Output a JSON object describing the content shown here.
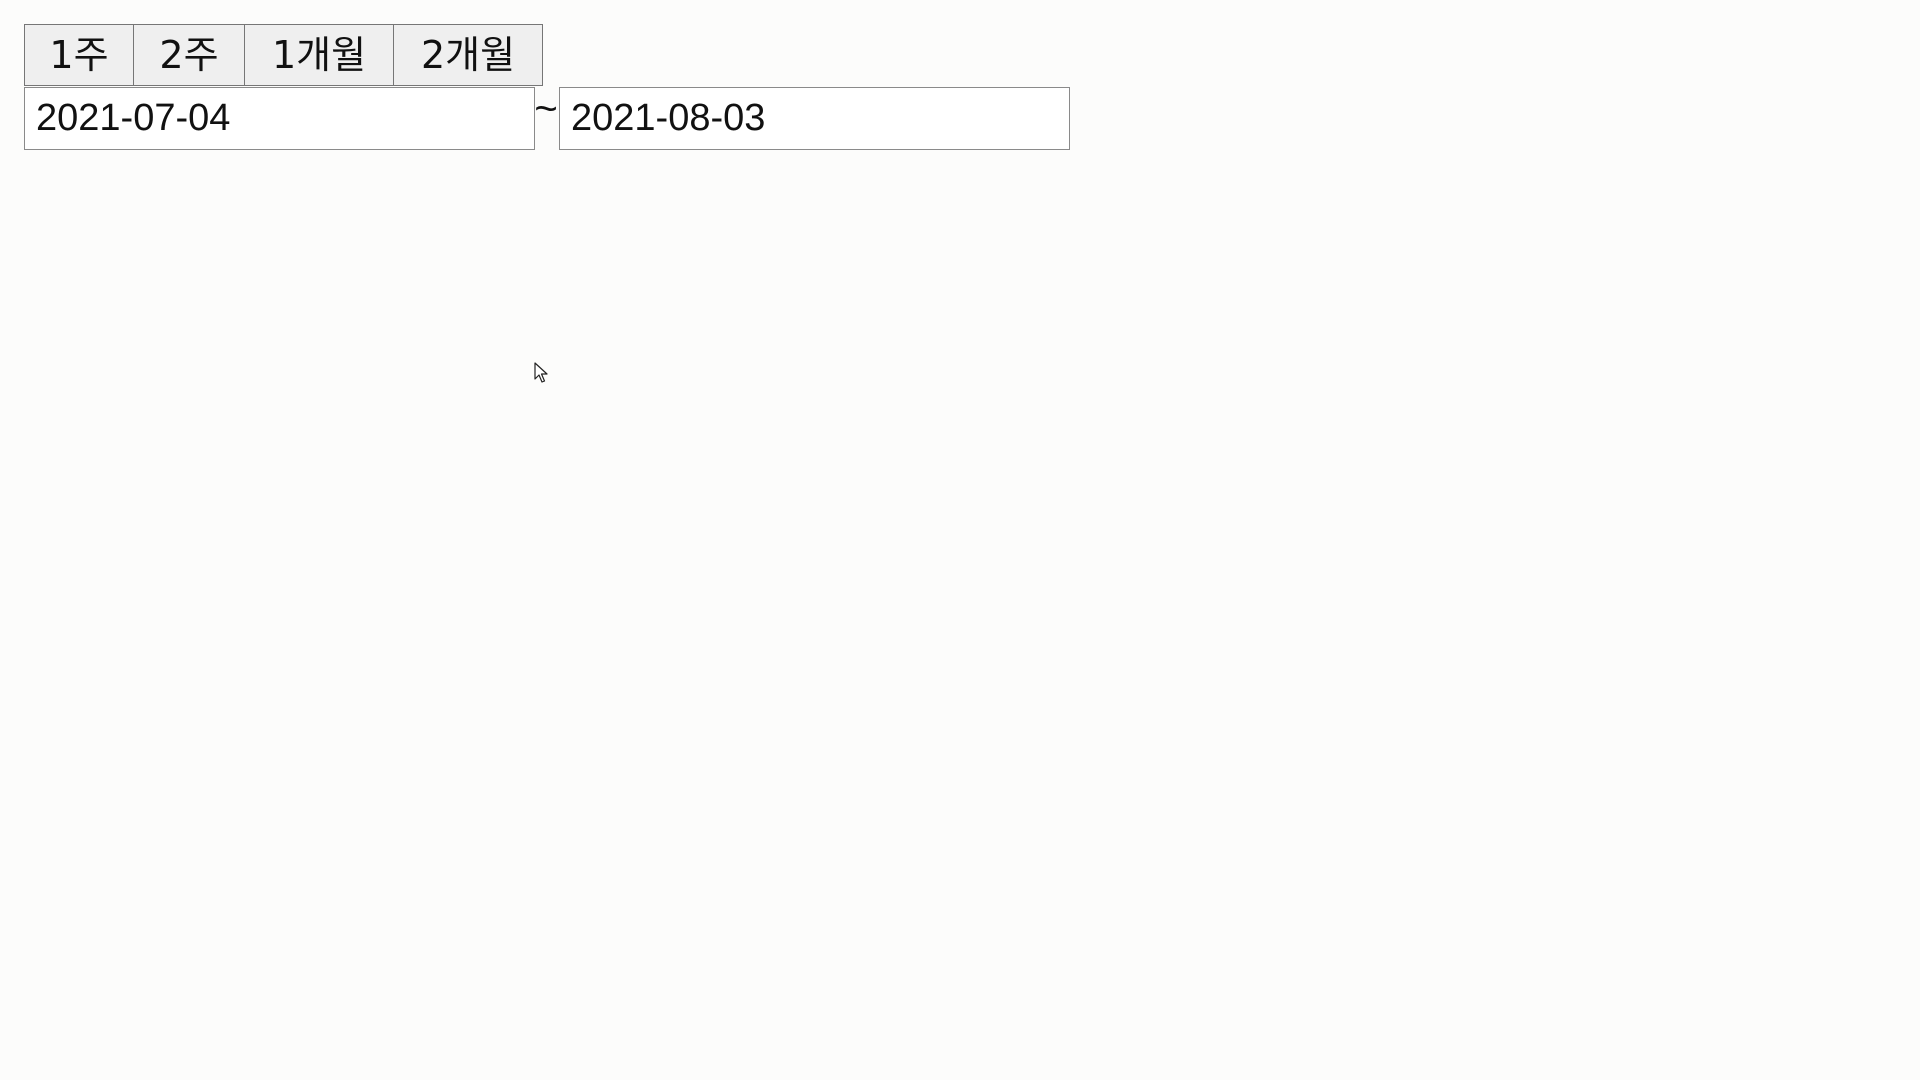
{
  "range_buttons": [
    {
      "label": "1주"
    },
    {
      "label": "2주"
    },
    {
      "label": "1개월"
    },
    {
      "label": "2개월"
    }
  ],
  "date_range": {
    "start_value": "2021-07-04",
    "separator": "~",
    "end_value": "2021-08-03"
  },
  "icons": {
    "cursor": "mouse-pointer-icon"
  },
  "colors": {
    "background": "#fcfcfb",
    "button_background": "#efefef",
    "border": "#767676"
  }
}
